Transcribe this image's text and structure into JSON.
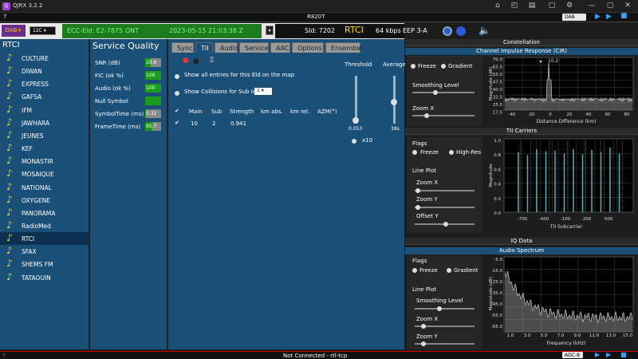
{
  "app": {
    "title": "QJRX 3.2.2",
    "version_icon": "q-logo"
  },
  "toolbar_icons": [
    "home-icon",
    "map-icon",
    "layers-icon",
    "chat-icon",
    "gear-icon",
    "minimize-icon",
    "maximize-icon",
    "close-icon"
  ],
  "row2": {
    "left": "7",
    "center": "R820T",
    "dab_select": "DAB"
  },
  "info": {
    "band": "DAB+",
    "channel": "12C",
    "ecc": "ECC-Eld: E2-7875",
    "country": "ONT",
    "datetime": "2023-05-15  21:03:38 Z",
    "sid": "SId: 7202",
    "station": "RTCI",
    "bitrate": "64 kbps",
    "eep": "EEP 3-A"
  },
  "sidebar": {
    "title": "RTCI",
    "stations": [
      "CULTURE",
      "DIWAN",
      "EXPRESS",
      "GAFSA",
      "IFM",
      "JAWHARA",
      "JEUNES",
      "KEF",
      "MONASTIR",
      "MOSAIQUE",
      "NATIONAL",
      "OXYGENE",
      "PANORAMA",
      "RadioMed",
      "RTCI",
      "SFAX",
      "SHEMS FM",
      "TATAOUIN"
    ],
    "selected": "RTCI"
  },
  "service_quality": {
    "title": "Service Quality",
    "rows": [
      {
        "label": "SNR (dB)",
        "value": "19.6",
        "fill": 0.35
      },
      {
        "label": "FIC (ok %)",
        "value": "100",
        "fill": 1.0
      },
      {
        "label": "Audio (ok %)",
        "value": "100",
        "fill": 1.0
      },
      {
        "label": "Null Symbol",
        "value": "",
        "fill": 1.0
      },
      {
        "label": "SymbolTime (ms)",
        "value": "0.32",
        "fill": 0.05
      },
      {
        "label": "FrameTime (ms)",
        "value": "95.7",
        "fill": 0.45
      }
    ]
  },
  "tabs": [
    "Sync",
    "TII",
    "Audio",
    "Service",
    "AAC",
    "Options",
    "Ensemble"
  ],
  "active_tab": "TII",
  "tii": {
    "show_all": "Show all entries for this Eld on the map",
    "show_collisions": "Show Collisions for Sub Id",
    "columns": [
      "Main",
      "Sub",
      "Strength",
      "km abs.",
      "km rel.",
      "AZM(°)"
    ],
    "rows": [
      {
        "main": "10",
        "sub": "2",
        "strength": "0.941"
      }
    ],
    "threshold_label": "Threshold",
    "average_label": "Average",
    "threshold_value": "0.053",
    "average_value": "38s",
    "x10": "x10"
  },
  "panels": {
    "constellation": "Constellation",
    "cir_title": "Channel Impulse Response (CIR)",
    "cir_ylabel": "Magnitude (dB)",
    "cir_xlabel": "Distance Difference (km)",
    "cir_peak": "10.2",
    "cir_yticks": [
      "70.0",
      "62.5",
      "55.0",
      "47.5",
      "40.0",
      "32.5",
      "25.0",
      "17.5"
    ],
    "cir_xticks": [
      "-40",
      "-20",
      "0",
      "20",
      "40",
      "60",
      "80"
    ],
    "freeze": "Freeze",
    "gradient": "Gradient",
    "smoothing": "Smoothing Level",
    "zoom_x": "Zoom X",
    "tii_carriers": "TII Carriers",
    "flags": "Flags",
    "high_res": "High-Res",
    "line_plot": "Line Plot",
    "zoom_y": "Zoom Y",
    "offset_y": "Offset Y",
    "tii_ylabel": "Magnitude",
    "tii_xlabel": "TII Subcarrier",
    "tii_yticks": [
      "1.0",
      "0.8",
      "0.6",
      "0.4",
      "0.2",
      "0.0"
    ],
    "tii_xticks": [
      "-700",
      "-400",
      "-100",
      "200",
      "500"
    ],
    "iq_data": "IQ Data",
    "audio_spectrum": "Audio Spectrum",
    "as_ylabel": "Magnitude (dB)",
    "as_xlabel": "Frequency (kHz)",
    "as_yticks": [
      "-5.0",
      "-15.0",
      "-25.0",
      "-35.0",
      "-45.0",
      "-55.0",
      "-65.0"
    ],
    "as_xticks": [
      "1.0",
      "3.0",
      "5.0",
      "7.0",
      "9.0",
      "11.0",
      "13.0",
      "15.0"
    ]
  },
  "status": {
    "text": "Not Connected - rtl-tcp",
    "left": "?",
    "adc": "ADC-8"
  }
}
